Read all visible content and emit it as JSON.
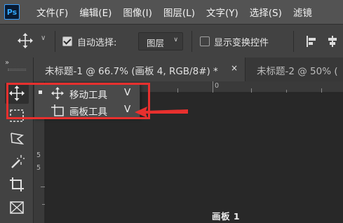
{
  "app": {
    "logo_text": "Ps"
  },
  "menu": [
    "文件(F)",
    "编辑(E)",
    "图像(I)",
    "图层(L)",
    "文字(Y)",
    "选择(S)",
    "滤镜"
  ],
  "options_bar": {
    "auto_select_label": "自动选择:",
    "auto_select_checked": true,
    "layer_select_value": "图层",
    "show_transform_label": "显示变换控件",
    "show_transform_checked": false
  },
  "tabs": [
    {
      "title": "未标题-1 @ 66.7% (画板 4, RGB/8#) *",
      "close": "×",
      "active": true
    },
    {
      "title": "未标题-2 @ 50% (",
      "active": false
    }
  ],
  "toolbar": {
    "collapse_glyph": "»",
    "tools": [
      "move-tool",
      "marquee-tool",
      "lasso-tool",
      "magic-wand-tool",
      "crop-tool",
      "frame-tool"
    ]
  },
  "ruler": {
    "top_label": "0",
    "left_label_1": "5",
    "left_label_2": "5"
  },
  "flyout": {
    "items": [
      {
        "label": "移动工具",
        "shortcut": "V",
        "selected": true
      },
      {
        "label": "画板工具",
        "shortcut": "V",
        "selected": false
      }
    ]
  },
  "canvas": {
    "artboard_label": "画板 1"
  },
  "colors": {
    "annotation": "#e8302e",
    "ps_blue": "#31a8ff"
  }
}
